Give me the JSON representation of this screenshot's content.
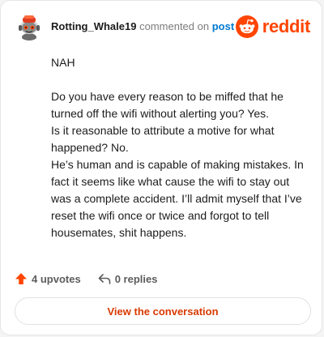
{
  "comment": {
    "username": "Rotting_Whale19",
    "action_text": "commented on",
    "target_link": "post",
    "brand": "reddit",
    "verdict": "NAH",
    "paragraphs": [
      "Do you have every reason to be miffed that he turned off the wifi without alerting you? Yes.",
      "Is it reasonable to attribute a motive for what happened? No.",
      "He’s human and is capable of making mistakes. In fact it seems like what cause the wifi to stay out was a complete accident. I’ll admit myself that I’ve reset the wifi once or twice and forgot to tell housemates, shit happens."
    ]
  },
  "stats": {
    "upvotes_label": "4 upvotes",
    "replies_label": "0 replies"
  },
  "actions": {
    "view_conversation_label": "View the conversation"
  },
  "icons": {
    "avatar": "snoo-avatar",
    "brand_logo": "reddit-logo-icon",
    "upvote": "upvote-arrow-icon",
    "reply": "reply-arrow-icon"
  },
  "colors": {
    "brand_orange": "#ff4500",
    "upvote_orange": "#ff4500",
    "link_blue": "#0079d3",
    "button_text": "#d93a00",
    "text_primary": "#1c1c1c",
    "text_secondary": "#7c7c7c"
  }
}
